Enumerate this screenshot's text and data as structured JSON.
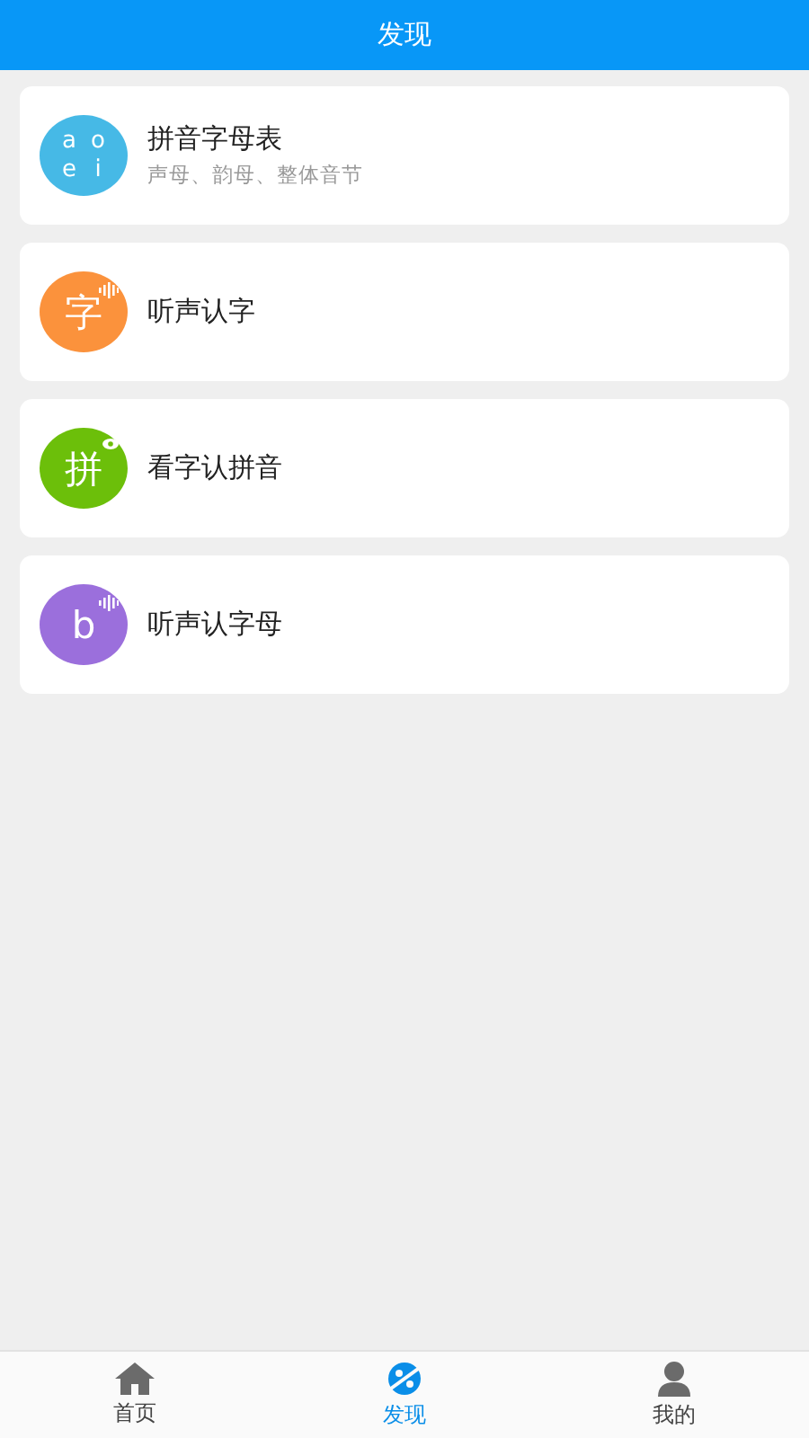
{
  "header": {
    "title": "发现"
  },
  "items": [
    {
      "kind": "grid",
      "color": "#46b9e6",
      "glyphs": [
        "a",
        "o",
        "e",
        "i"
      ],
      "title": "拼音字母表",
      "subtitle": "声母、韵母、整体音节"
    },
    {
      "kind": "sound",
      "color": "#fb923c",
      "glyphs": [
        "字"
      ],
      "title": "听声认字"
    },
    {
      "kind": "eye",
      "color": "#6cbf0a",
      "glyphs": [
        "拼"
      ],
      "title": "看字认拼音"
    },
    {
      "kind": "sound",
      "color": "#9b6fdc",
      "glyphs": [
        "b"
      ],
      "title": "听声认字母"
    }
  ],
  "tabs": [
    {
      "kind": "home",
      "label": "首页",
      "selected": false
    },
    {
      "kind": "discover",
      "label": "发现",
      "selected": true
    },
    {
      "kind": "me",
      "label": "我的",
      "selected": false
    }
  ]
}
